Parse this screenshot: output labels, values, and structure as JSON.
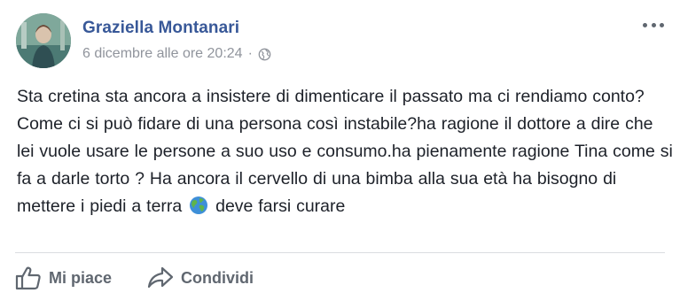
{
  "post": {
    "author": "Graziella Montanari",
    "timestamp": "6 dicembre alle ore 20:24",
    "separator": "·",
    "privacy_icon": "globe-icon",
    "text_part1": "Sta cretina sta ancora a insistere di dimenticare il passato ma ci rendiamo conto? Come ci si può fidare di una persona così instabile?ha ragione il dottore a dire che lei vuole usare le persone a suo uso e consumo.ha pienamente ragione Tina come si fa a darle torto ? Ha ancora il cervello di una bimba alla sua età ha bisogno di mettere i piedi a terra",
    "emoji": "earth-emoji",
    "text_part2": "deve farsi curare"
  },
  "actions": {
    "like_label": "Mi piace",
    "share_label": "Condividi"
  },
  "colors": {
    "author": "#385898",
    "meta": "#90949c",
    "body_text": "#1d2129",
    "action_text": "#606770",
    "divider": "#dadde1"
  }
}
